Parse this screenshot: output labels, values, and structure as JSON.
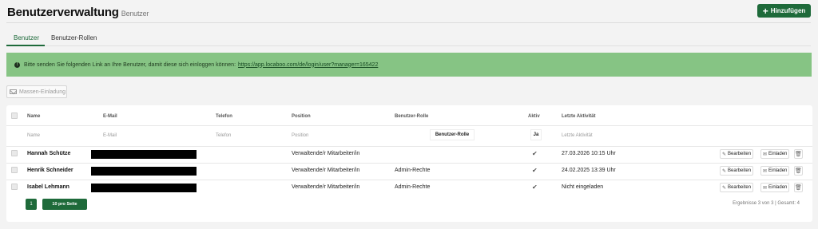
{
  "header": {
    "title": "Benutzerverwaltung",
    "subtitle": "Benutzer",
    "add_label": "Hinzufügen"
  },
  "tabs": [
    {
      "label": "Benutzer",
      "active": true
    },
    {
      "label": "Benutzer-Rollen",
      "active": false
    }
  ],
  "alert": {
    "message": "Bitte senden Sie folgenden Link an Ihre Benutzer, damit diese sich einloggen können:",
    "link": "https://app.locaboo.com/de/login/user?manager=165422"
  },
  "mass_invite_label": "Massen-Einladung",
  "table": {
    "columns": {
      "name": "Name",
      "email": "E-Mail",
      "phone": "Telefon",
      "position": "Position",
      "role": "Benutzer-Rolle",
      "active": "Aktiv",
      "last_activity": "Letzte Aktivität"
    },
    "filters": {
      "name": "Name",
      "email": "E-Mail",
      "phone": "Telefon",
      "position": "Position",
      "role": "Benutzer-Rolle",
      "active": "Ja",
      "last_activity": "Letzte Aktivität"
    },
    "rows": [
      {
        "name": "Hannah Schütze",
        "position": "Verwaltende/r Mitarbeiter/in",
        "role": "",
        "active": true,
        "last_activity": "27.03.2026 10:15 Uhr"
      },
      {
        "name": "Henrik Schneider",
        "position": "Verwaltende/r Mitarbeiter/in",
        "role": "Admin-Rechte",
        "active": true,
        "last_activity": "24.02.2025 13:39 Uhr"
      },
      {
        "name": "Isabel Lehmann",
        "position": "Verwaltende/r Mitarbeiter/in",
        "role": "Admin-Rechte",
        "active": true,
        "last_activity": "Nicht eingeladen"
      }
    ],
    "edit_label": "Bearbeiten",
    "invite_label": "Einladen"
  },
  "pagination": {
    "current_page": "1",
    "per_page_label": "10 pro Seite",
    "results": "Ergebnisse 3 von 3 | Gesamt: 4"
  },
  "colors": {
    "primary": "#1e6a3a",
    "alert_bg": "#86c484"
  }
}
